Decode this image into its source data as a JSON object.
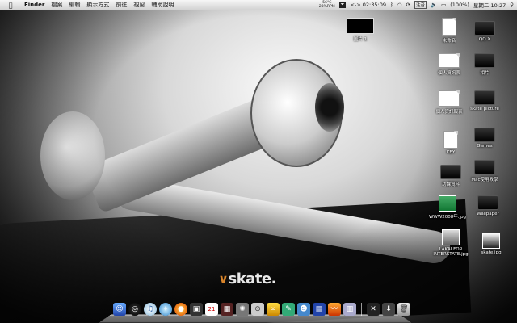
{
  "menubar": {
    "apple": "",
    "app": "Finder",
    "menus": [
      "檔案",
      "編輯",
      "顯示方式",
      "前往",
      "視窗",
      "輔助說明"
    ],
    "temp_top": "56°C",
    "temp_bottom": "23%RPM",
    "timer": "<-> 02:35:09",
    "ime": "注音",
    "battery": "(100%)",
    "clock": "星期二 10:27"
  },
  "desktop": {
    "logo_text": "skate.",
    "icons": [
      {
        "label": "圖片 1",
        "type": "screen"
      },
      {
        "label": "未命名",
        "type": "doc"
      },
      {
        "label": "QQ X",
        "type": "folder"
      },
      {
        "label": "個人資訊表",
        "type": "doc"
      },
      {
        "label": "相片",
        "type": "folder"
      },
      {
        "label": "個人資訊報表",
        "type": "doc"
      },
      {
        "label": "skate picture",
        "type": "folder"
      },
      {
        "label": "KEY",
        "type": "doc"
      },
      {
        "label": "Games",
        "type": "folder"
      },
      {
        "label": "功課資料",
        "type": "folder"
      },
      {
        "label": "Mac使用教學",
        "type": "folder"
      },
      {
        "label": "WWW2008年.jpg",
        "type": "photo"
      },
      {
        "label": "Wallpaper",
        "type": "folder"
      },
      {
        "label": "LAKAI FOR INTERSTATE.jpg",
        "type": "photo"
      },
      {
        "label": "skate.jpg",
        "type": "photo"
      }
    ]
  },
  "dock": {
    "apps": [
      "finder-icon",
      "dashboard-icon",
      "itunes-icon",
      "safari-icon",
      "firefox-icon",
      "photo-icon",
      "calendar-icon",
      "film-icon",
      "skate-icon",
      "preview-icon",
      "messenger-icon",
      "word-icon",
      "people-icon",
      "network-icon",
      "activity-icon",
      "excel-icon"
    ],
    "right": [
      "x11-icon",
      "downloads-icon",
      "trash-icon"
    ]
  }
}
